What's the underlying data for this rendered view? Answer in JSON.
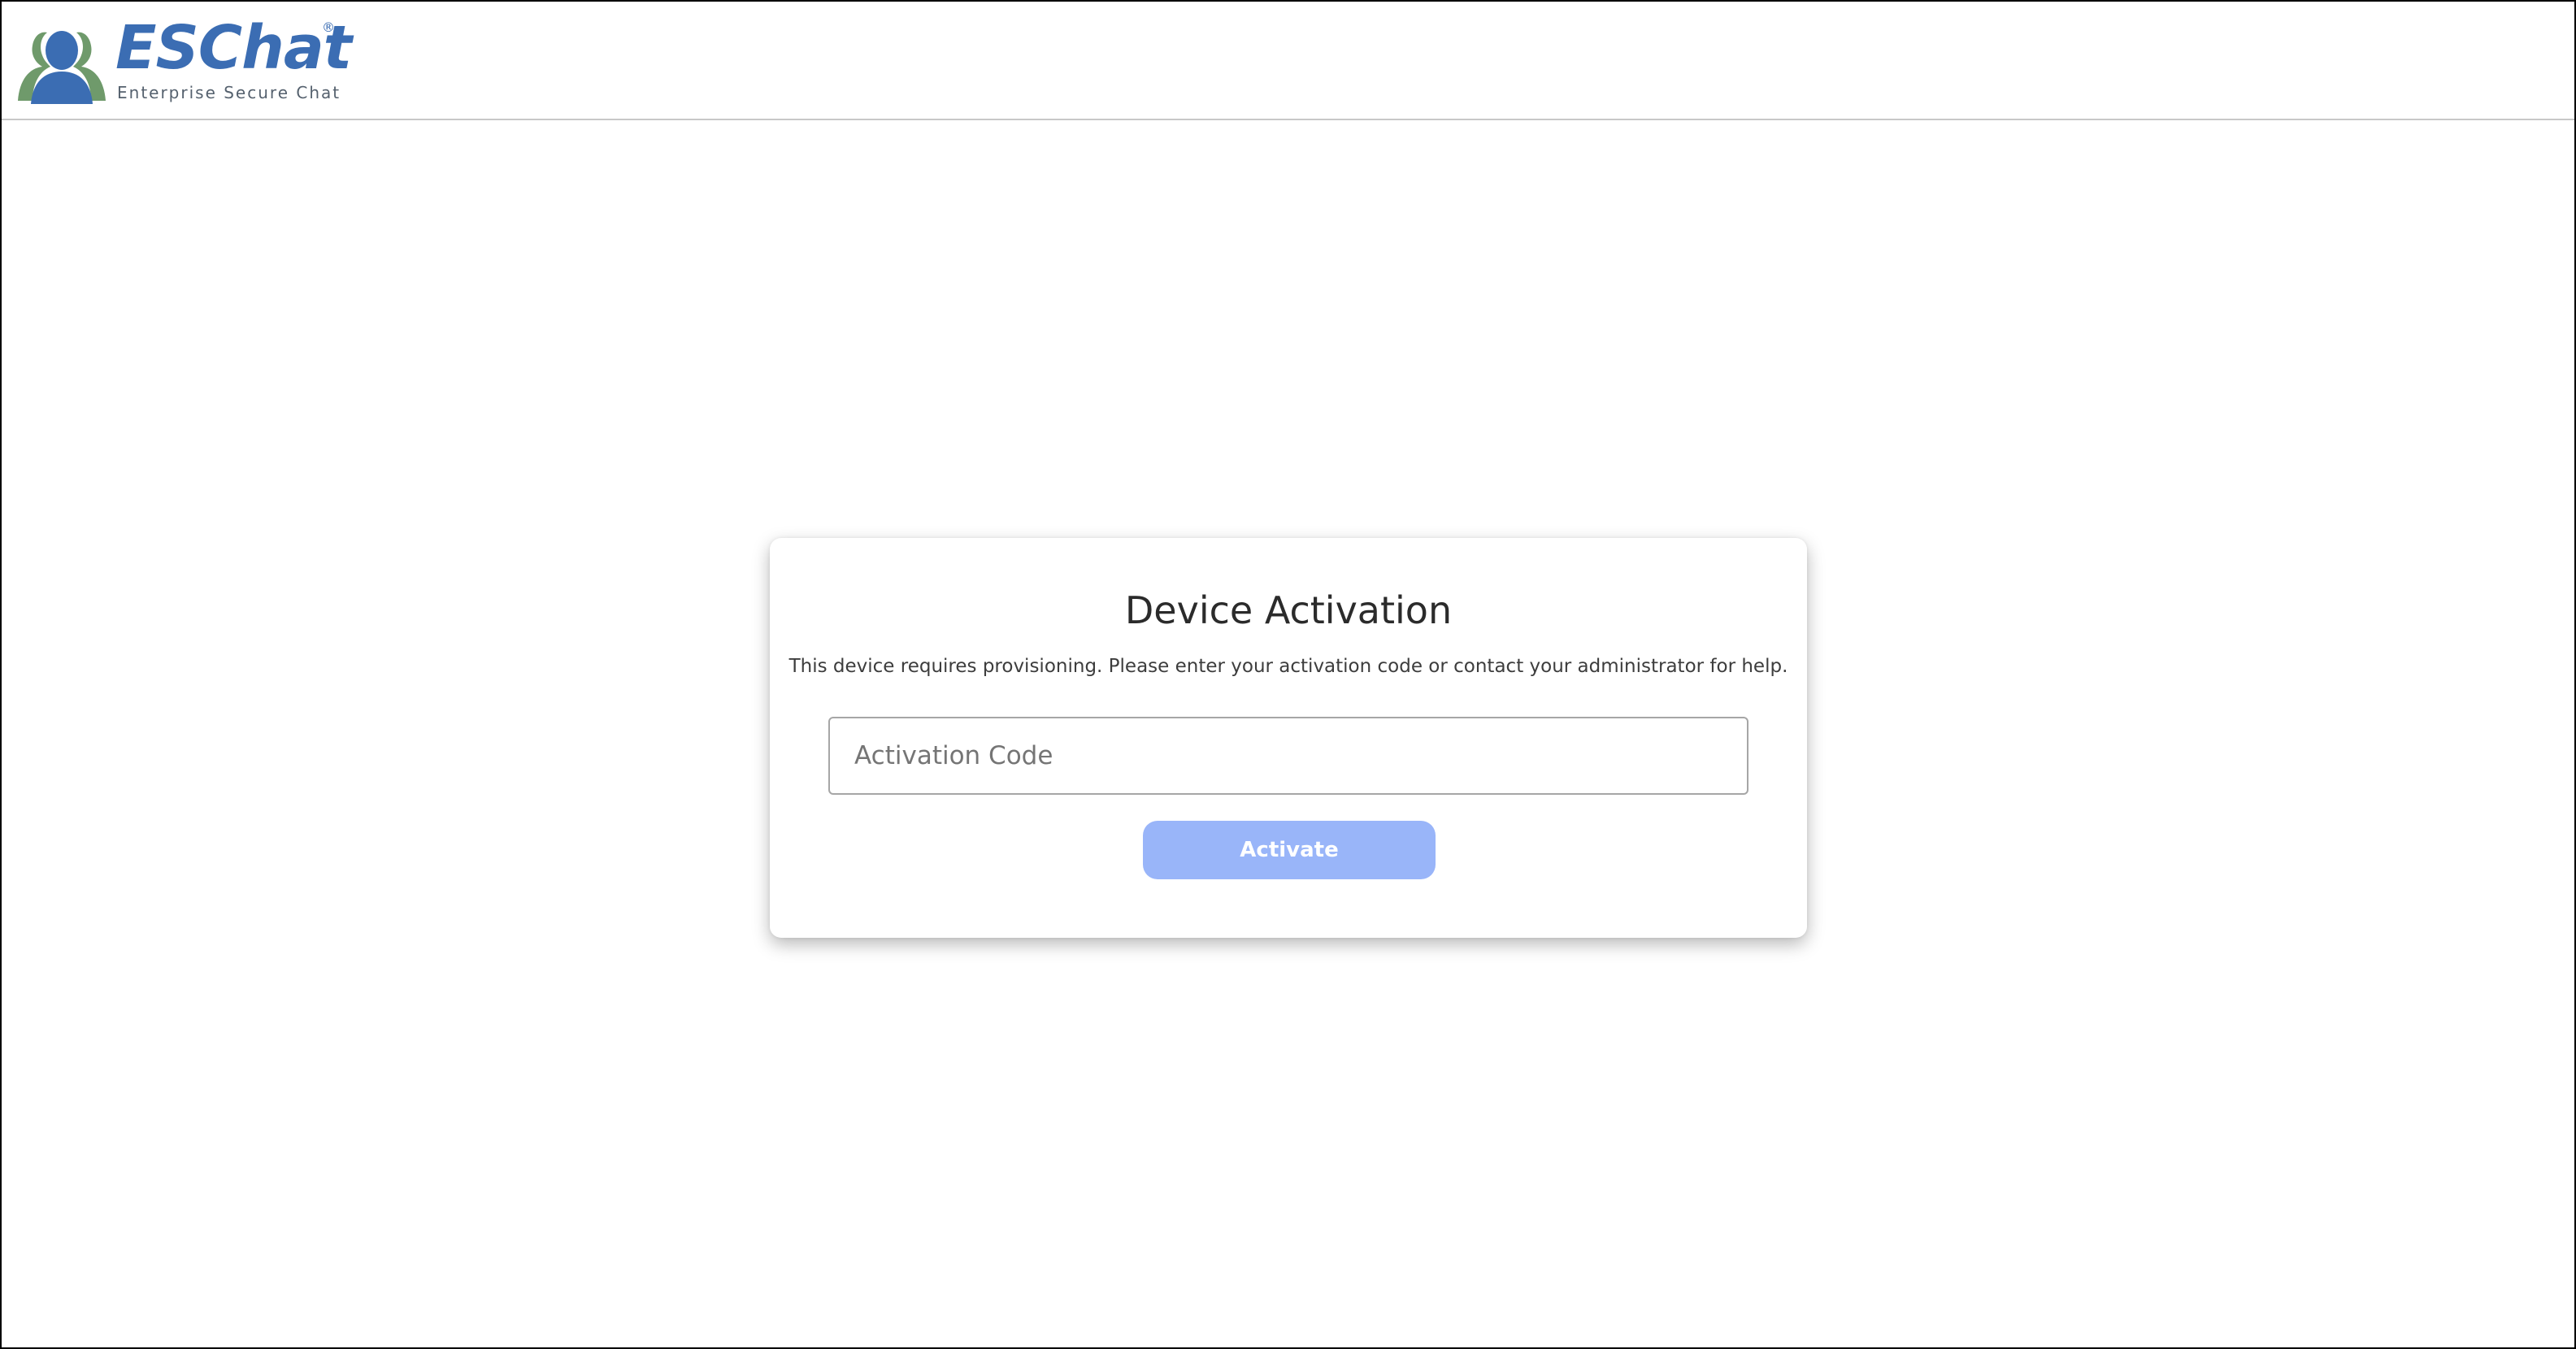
{
  "header": {
    "logo": {
      "icon": "people-icon",
      "wordmark": "ESChat",
      "registered_mark": "®",
      "tagline": "Enterprise Secure Chat",
      "brand_color": "#3b6db3",
      "accent_color": "#6f9a6b"
    }
  },
  "activation": {
    "title": "Device Activation",
    "description": "This device requires provisioning. Please enter your activation code or contact your administrator for help.",
    "code_input": {
      "placeholder": "Activation Code",
      "value": ""
    },
    "activate_label": "Activate",
    "button_color": "#99b5f9"
  }
}
